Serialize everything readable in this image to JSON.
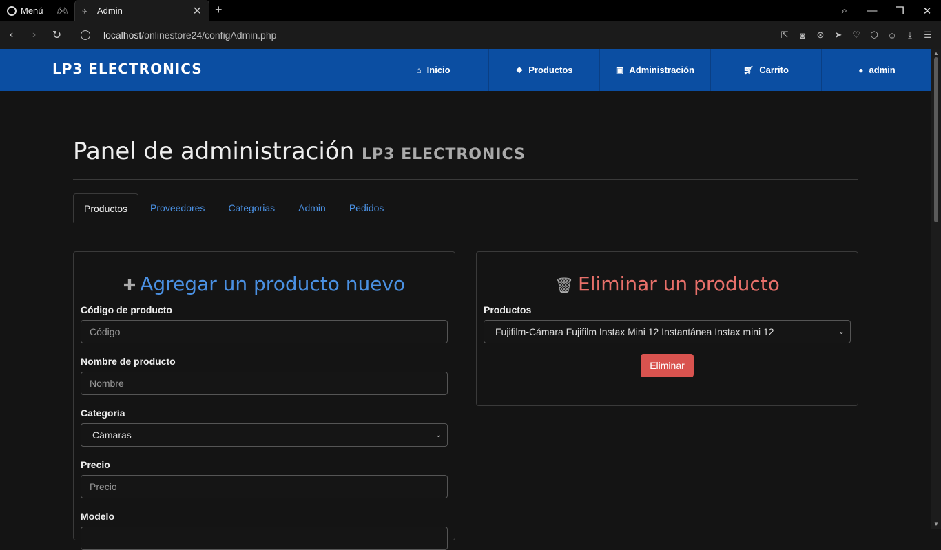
{
  "browser": {
    "menu_label": "Menú",
    "tab_title": "Admin",
    "url_host": "localhost",
    "url_path": "/onlinestore24/configAdmin.php"
  },
  "navbar": {
    "brand": "LP3 ELECTRONICS",
    "items": [
      {
        "label": "Inicio",
        "icon": "home-icon"
      },
      {
        "label": "Productos",
        "icon": "dropbox-icon"
      },
      {
        "label": "Administración",
        "icon": "briefcase-icon"
      },
      {
        "label": "Carrito",
        "icon": "cart-icon"
      },
      {
        "label": "admin",
        "icon": "user-icon"
      }
    ]
  },
  "page": {
    "title": "Panel de administración",
    "brand_sub": "LP3 ELECTRONICS",
    "tabs": [
      "Productos",
      "Proveedores",
      "Categorias",
      "Admin",
      "Pedidos"
    ],
    "active_tab": "Productos"
  },
  "add_form": {
    "title": "Agregar un producto nuevo",
    "code_label": "Código de producto",
    "code_placeholder": "Código",
    "name_label": "Nombre de producto",
    "name_placeholder": "Nombre",
    "category_label": "Categoría",
    "category_value": "Cámaras",
    "price_label": "Precio",
    "price_placeholder": "Precio",
    "model_label": "Modelo"
  },
  "delete_form": {
    "title": "Eliminar un producto",
    "products_label": "Productos",
    "selected_product": "Fujifilm-Cámara Fujifilm Instax Mini 12 Instantánea Instax mini 12",
    "delete_button": "Eliminar"
  },
  "colors": {
    "navbar": "#0b4ea2",
    "link": "#4a90e2",
    "danger": "#d9534f",
    "danger_title": "#e8706a"
  }
}
